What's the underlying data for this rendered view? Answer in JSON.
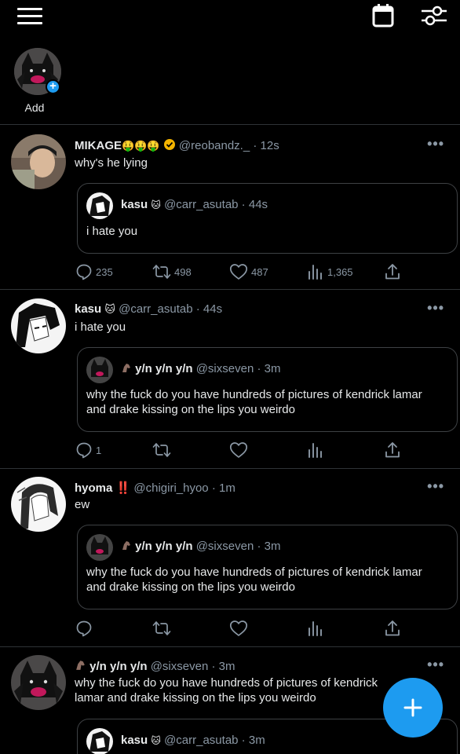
{
  "header": {
    "menu_icon": "hamburger-menu-icon",
    "calendar_icon": "calendar-icon",
    "settings_icon": "sliders-icon"
  },
  "fleets": {
    "add_label": "Add"
  },
  "tweets": [
    {
      "name": "MIKAGE",
      "emojis": "🤑🤑🤑",
      "handle": "@reobandz._",
      "time": "12s",
      "text": "why's he lying",
      "quote": {
        "name": "kasu",
        "emoji": "🐱",
        "handle": "@carr_asutab",
        "time": "44s",
        "text": "i hate you"
      },
      "stats": {
        "replies": "235",
        "retweets": "498",
        "likes": "487",
        "views": "1,365"
      }
    },
    {
      "name": "kasu",
      "emoji": "🐱",
      "handle": "@carr_asutab",
      "time": "44s",
      "text": "i hate you",
      "quote": {
        "name": "y/n y/n y/n",
        "handle": "@sixseven",
        "time": "3m",
        "text": "why the fuck do you have hundreds of pictures of kendrick lamar and drake kissing on the lips you weirdo"
      },
      "stats": {
        "replies": "1"
      }
    },
    {
      "name": "hyoma ‼️",
      "handle": "@chigiri_hyoo",
      "time": "1m",
      "text": "ew",
      "quote": {
        "name": "y/n y/n y/n",
        "handle": "@sixseven",
        "time": "3m",
        "text": "why the fuck do you have hundreds of pictures of kendrick lamar and drake kissing on the lips you weirdo"
      }
    },
    {
      "name": "y/n y/n y/n",
      "handle": "@sixseven",
      "time": "3m",
      "text": "why the fuck do you have hundreds of pictures of kendrick lamar and drake kissing on the lips you weirdo",
      "quote": {
        "name": "kasu",
        "emoji": "🐱",
        "handle": "@carr_asutab",
        "time": "3m"
      }
    }
  ],
  "colors": {
    "background": "#000000",
    "accent": "#1d9bf0",
    "muted": "#8b98a5",
    "border": "#2f3336"
  }
}
